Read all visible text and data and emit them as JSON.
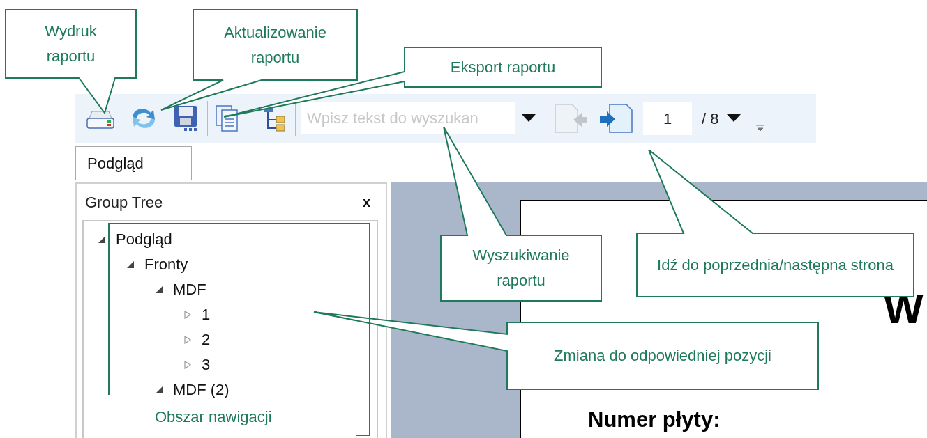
{
  "toolbar": {
    "search": {
      "placeholder": "Wpisz tekst do wyszukan"
    },
    "previous_page": {
      "disabled": true
    },
    "next_page": {
      "disabled": false
    },
    "page_number": "1",
    "page_total": "/ 8"
  },
  "tabs": [
    {
      "label": "Podgląd",
      "selected": true
    }
  ],
  "group_tree": {
    "title": "Group Tree",
    "close": "x",
    "items": [
      {
        "label": "Podgląd",
        "expanded": true,
        "children": [
          {
            "label": "Fronty",
            "expanded": true,
            "children": [
              {
                "label": "MDF",
                "expanded": true,
                "children": [
                  {
                    "label": "1",
                    "expanded": false
                  },
                  {
                    "label": "2",
                    "expanded": false
                  },
                  {
                    "label": "3",
                    "expanded": false
                  }
                ]
              },
              {
                "label": "MDF (2)",
                "expanded": true
              }
            ]
          }
        ]
      }
    ]
  },
  "report_page": {
    "heading": "W",
    "lines": [
      "Numer płyty:"
    ]
  },
  "callouts": [
    {
      "text": "Wydruk raportu"
    },
    {
      "text": "Aktualizowanie raportu"
    },
    {
      "text": "Eksport raportu"
    },
    {
      "text": "Wyszukiwanie raportu"
    },
    {
      "text": "Idź do poprzednia/następna strona"
    },
    {
      "text": "Zmiana do odpowiedniej pozycji"
    },
    {
      "text": "Obszar nawigacji"
    }
  ]
}
